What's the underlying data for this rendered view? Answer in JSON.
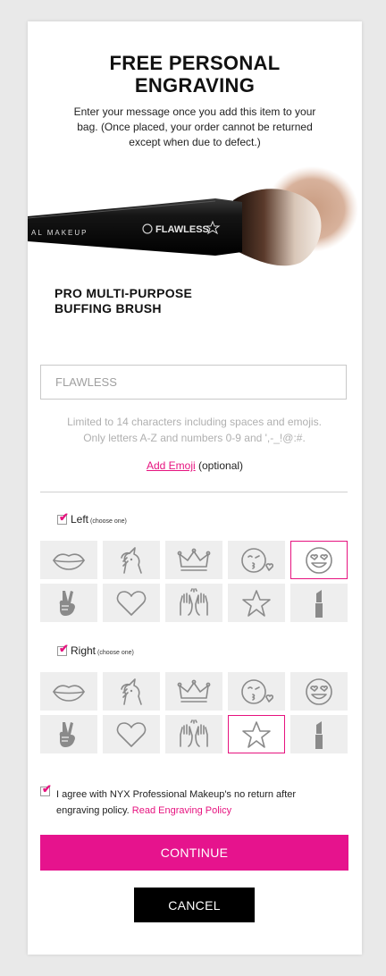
{
  "header": {
    "title_line1": "FREE PERSONAL",
    "title_line2": "ENGRAVING",
    "subtitle": "Enter your message once you add this item to your bag. (Once placed, your order cannot be returned except when due to defect.)"
  },
  "product": {
    "name_line1": "PRO MULTI-PURPOSE",
    "name_line2": "BUFFING BRUSH",
    "image_text": {
      "handle": "AL MAKEUP",
      "engraving": "FLAWLESS"
    }
  },
  "engraving": {
    "placeholder": "FLAWLESS",
    "hint_line1": "Limited to 14 characters including spaces and emojis.",
    "hint_line2": "Only letters A-Z and numbers 0-9 and ',-_!@:#.",
    "add_emoji_label": "Add Emoji",
    "optional_label": "(optional)"
  },
  "left_section": {
    "label": "Left",
    "sub": "(choose one)",
    "checked": true,
    "icons": [
      "lips-icon",
      "unicorn-icon",
      "crown-icon",
      "kiss-face-icon",
      "heart-eyes-icon",
      "peace-hand-icon",
      "heart-icon",
      "raised-hands-icon",
      "star-icon",
      "lipstick-icon"
    ],
    "selected": "heart-eyes-icon"
  },
  "right_section": {
    "label": "Right",
    "sub": "(choose one)",
    "checked": true,
    "icons": [
      "lips-icon",
      "unicorn-icon",
      "crown-icon",
      "kiss-face-icon",
      "heart-eyes-icon",
      "peace-hand-icon",
      "heart-icon",
      "raised-hands-icon",
      "star-icon",
      "lipstick-icon"
    ],
    "selected": "star-icon"
  },
  "agreement": {
    "checked": true,
    "text": "I agree with NYX Professional Makeup's no return after engraving policy.",
    "link": "Read Engraving Policy"
  },
  "actions": {
    "continue_label": "CONTINUE",
    "cancel_label": "CANCEL"
  },
  "colors": {
    "accent": "#e6138d",
    "link": "#e6137f",
    "tile_bg": "#eeeeee",
    "icon_stroke": "#8a8a8a"
  }
}
